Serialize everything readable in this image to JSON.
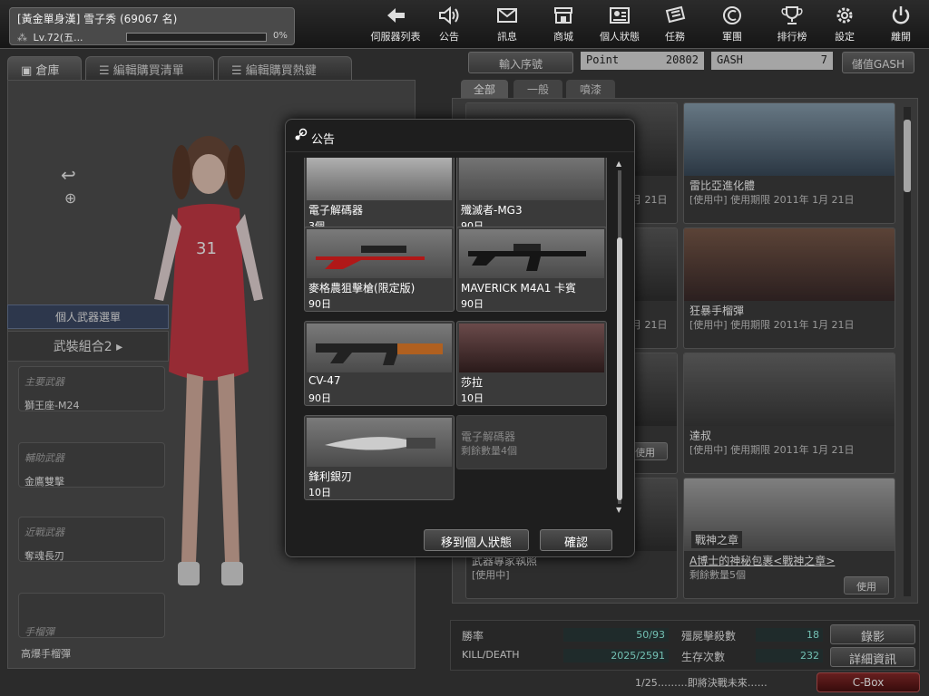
{
  "player": {
    "name": "[黃金單身漢] 雪子秀 (69067 名)",
    "level": "Lv.72(五...",
    "exp_percent": "0%",
    "exp_fraction": 0
  },
  "nav": [
    {
      "label": "伺服器列表",
      "icon": "back-arrow-icon"
    },
    {
      "label": "公告",
      "icon": "speaker-icon"
    },
    {
      "label": "訊息",
      "icon": "mail-icon"
    },
    {
      "label": "商城",
      "icon": "shop-icon"
    },
    {
      "label": "個人狀態",
      "icon": "profile-card-icon"
    },
    {
      "label": "任務",
      "icon": "mission-icon"
    },
    {
      "label": "軍團",
      "icon": "clan-shield-icon"
    },
    {
      "label": "排行榜",
      "icon": "trophy-icon"
    },
    {
      "label": "設定",
      "icon": "gear-icon"
    },
    {
      "label": "離開",
      "icon": "power-icon"
    }
  ],
  "left_tabs": {
    "warehouse": "倉庫",
    "edit_list": "編輯購買清單",
    "edit_hot": "編輯購買熱鍵"
  },
  "weapon_panel": {
    "header": "個人武器選單",
    "set_name": "武裝組合2",
    "slots": [
      {
        "category": "主要武器",
        "name": "獅王座-M24"
      },
      {
        "category": "輔助武器",
        "name": "金鷹雙擊"
      },
      {
        "category": "近戰武器",
        "name": "奪魂長刃"
      },
      {
        "category": "手榴彈",
        "name": "高爆手榴彈"
      }
    ]
  },
  "shop": {
    "serial_button": "輸入序號",
    "point_label": "Point",
    "point_value": "20802",
    "gash_label": "GASH",
    "gash_value": "7",
    "topup_button": "儲值GASH",
    "tabs": [
      "全部",
      "一般",
      "噴漆"
    ],
    "cards": [
      {
        "title": "",
        "status": "月 21日"
      },
      {
        "title": "雷比亞進化體",
        "status": "[使用中] 使用期限 2011年 1月 21日"
      },
      {
        "title": "",
        "status": "月 21日"
      },
      {
        "title": "狂暴手榴彈",
        "status": "[使用中] 使用期限 2011年 1月 21日"
      },
      {
        "title": "",
        "status": "",
        "button": "使用"
      },
      {
        "title": "達叔",
        "status": "[使用中] 使用期限 2011年 1月 21日"
      },
      {
        "title": "武器專家執照",
        "status": "[使用中]"
      },
      {
        "title": "A博士的神秘包裹<戰神之章>",
        "status": "剩餘數量5個",
        "button": "使用",
        "badge": "戰神之章"
      }
    ]
  },
  "stats": {
    "win_rate_label": "勝率",
    "win_rate_value": "50/93",
    "kd_label": "KILL/DEATH",
    "kd_value": "2025/2591",
    "zombie_kills_label": "殭屍擊殺數",
    "zombie_kills_value": "18",
    "survive_label": "生存次數",
    "survive_value": "232",
    "record_button": "錄影",
    "detail_button": "詳細資訊"
  },
  "ticker": "1/25………即將決戰未來……",
  "cbox": "C-Box",
  "dialog": {
    "title": "公告",
    "items": [
      {
        "name": "電子解碼器",
        "qty": "3個"
      },
      {
        "name": "殲滅者-MG3",
        "qty": "90日"
      },
      {
        "name": "麥格農狙擊槍(限定版)",
        "qty": "90日"
      },
      {
        "name": "MAVERICK M4A1 卡賓",
        "qty": "90日"
      },
      {
        "name": "CV-47",
        "qty": "90日"
      },
      {
        "name": "莎拉",
        "qty": "10日"
      },
      {
        "name": "鋒利銀刃",
        "qty": "10日"
      }
    ],
    "ghost_item": {
      "name": "電子解碼器",
      "qty": "剩餘數量4個"
    },
    "move_button": "移到個人狀態",
    "confirm_button": "確認"
  },
  "colors": {
    "accent": "#8a2a2a",
    "stat_value": "#99eeee"
  }
}
